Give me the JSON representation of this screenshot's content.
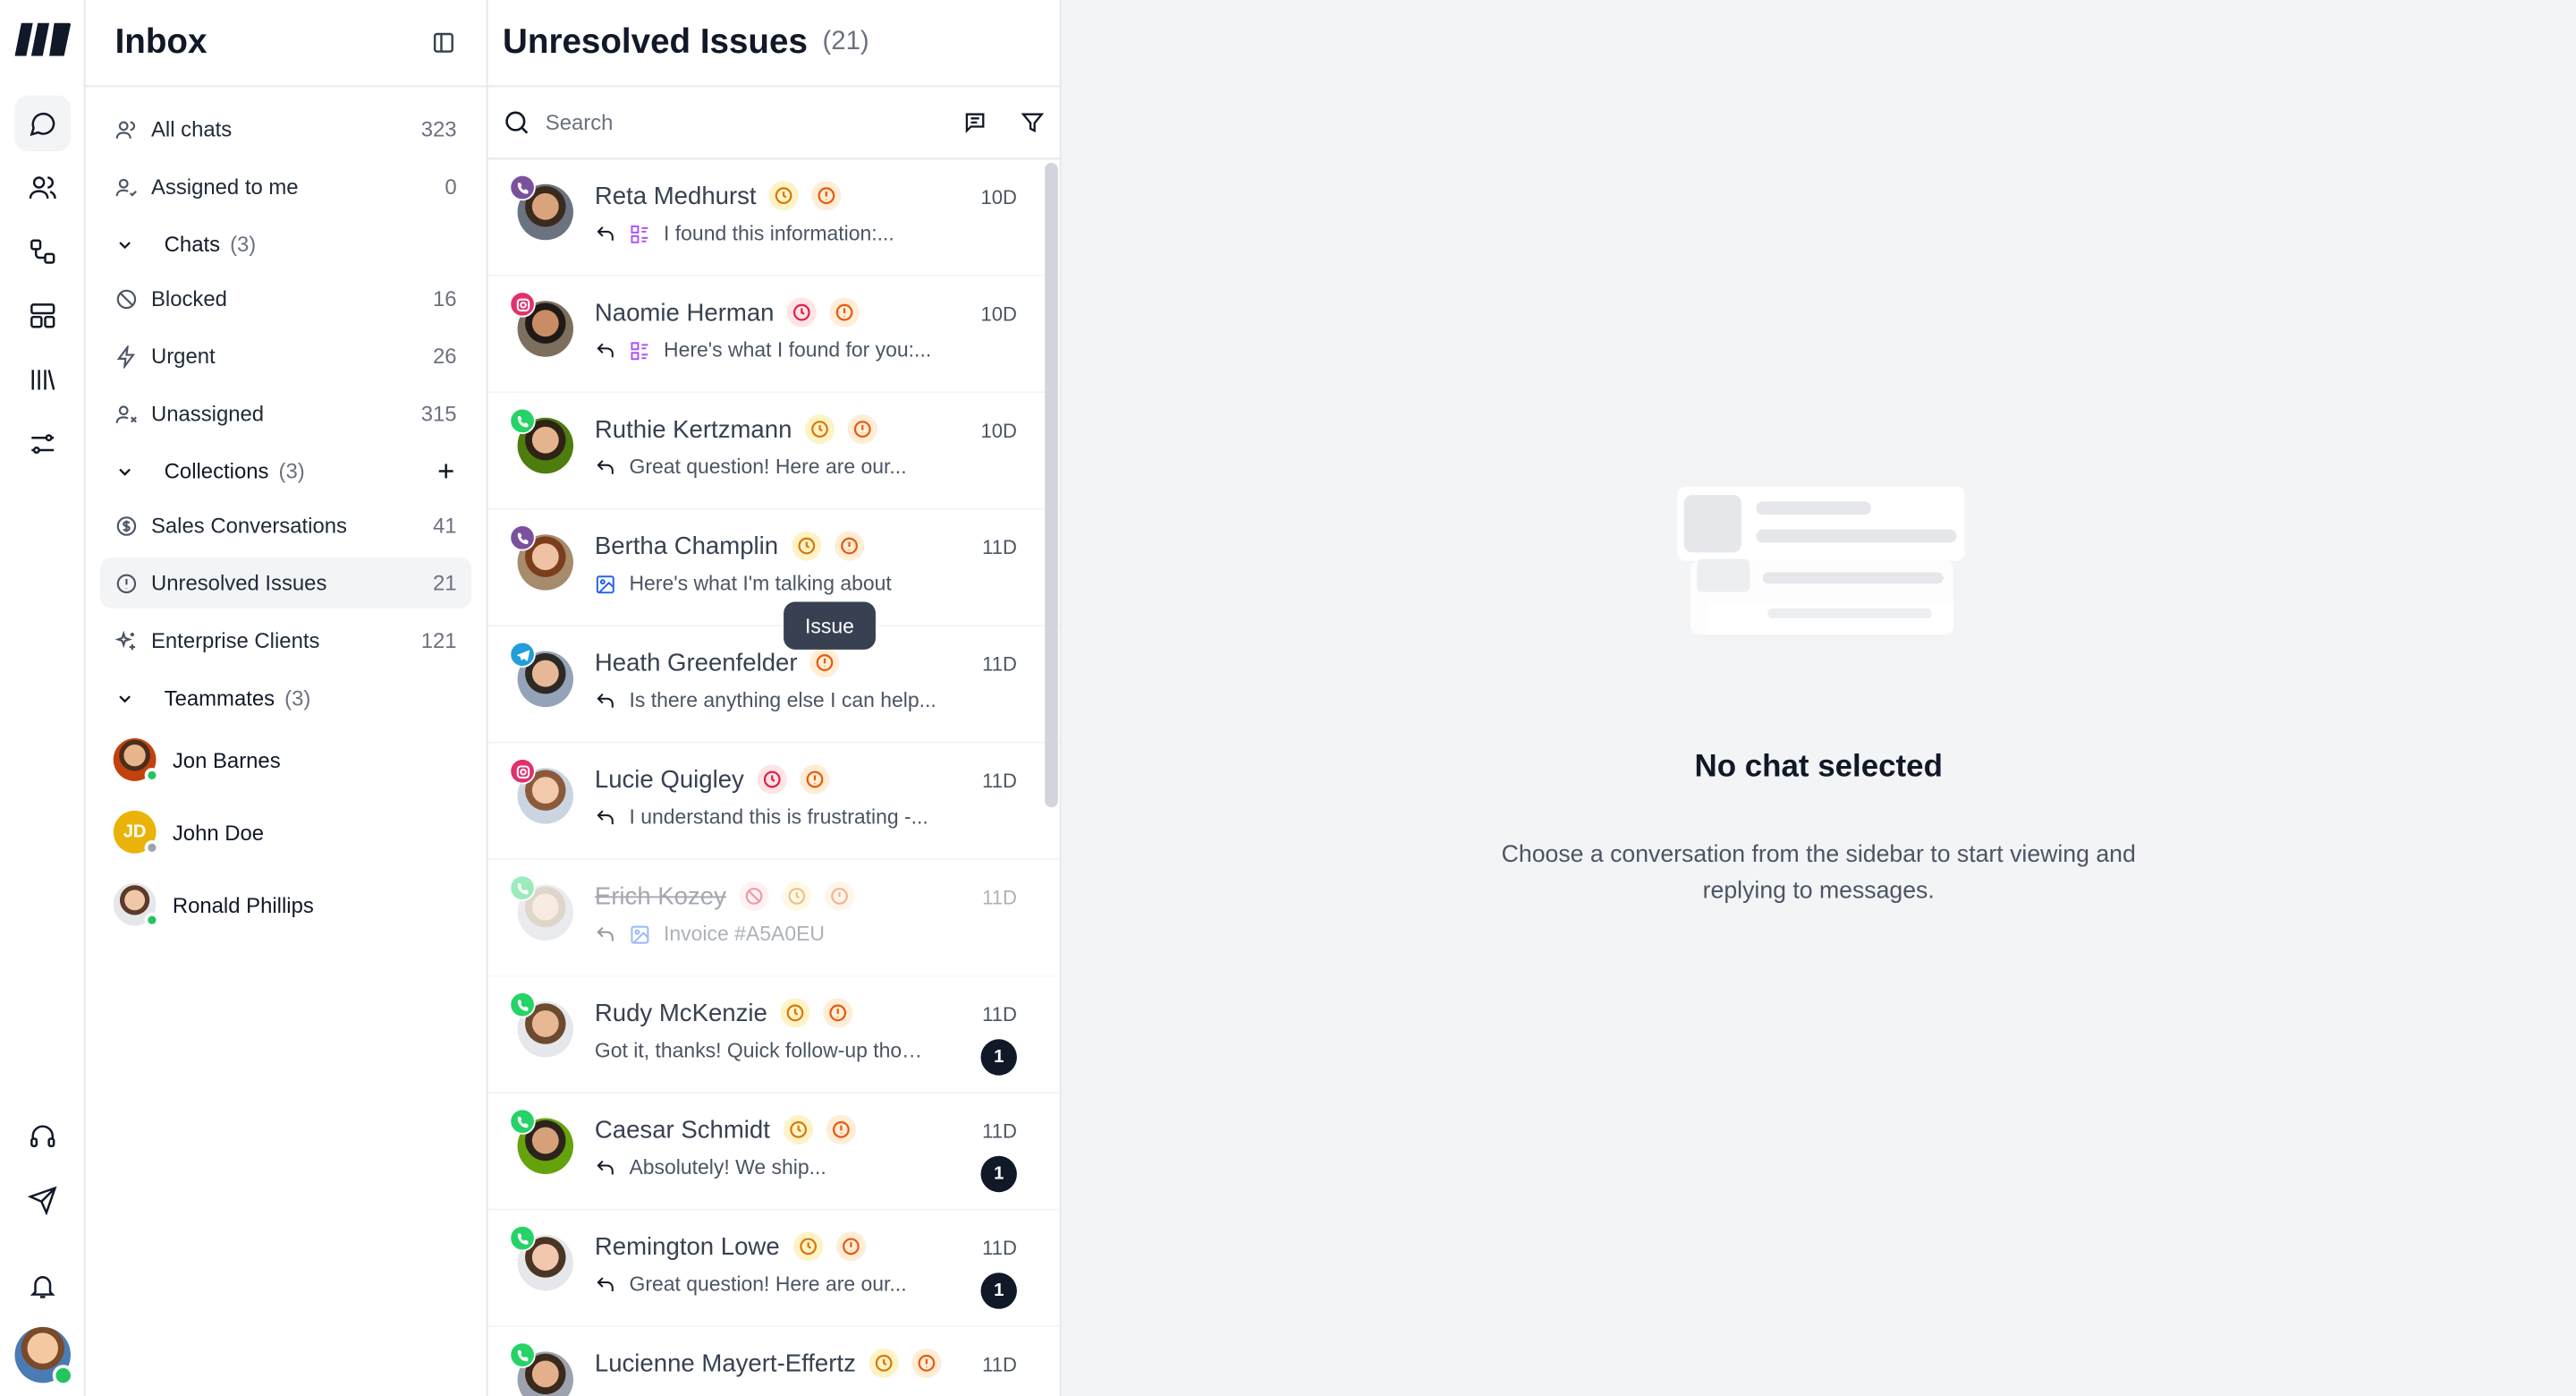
{
  "inbox": {
    "title": "Inbox",
    "nav": [
      {
        "label": "All chats",
        "count": "323",
        "icon": "users-icon"
      },
      {
        "label": "Assigned to me",
        "count": "0",
        "icon": "user-check-icon"
      }
    ],
    "chats_group": {
      "label": "Chats",
      "count": "(3)"
    },
    "chats_items": [
      {
        "label": "Blocked",
        "count": "16",
        "icon": "ban-icon"
      },
      {
        "label": "Urgent",
        "count": "26",
        "icon": "bolt-icon"
      },
      {
        "label": "Unassigned",
        "count": "315",
        "icon": "user-x-icon"
      }
    ],
    "collections_group": {
      "label": "Collections",
      "count": "(3)"
    },
    "collections_items": [
      {
        "label": "Sales Conversations",
        "count": "41",
        "icon": "dollar-icon"
      },
      {
        "label": "Unresolved Issues",
        "count": "21",
        "icon": "alert-circle-icon"
      },
      {
        "label": "Enterprise Clients",
        "count": "121",
        "icon": "sparkles-icon"
      }
    ],
    "teammates_group": {
      "label": "Teammates",
      "count": "(3)"
    },
    "teammates": [
      {
        "name": "Jon Barnes",
        "status": "online",
        "initials": ""
      },
      {
        "name": "John Doe",
        "status": "away",
        "initials": "JD"
      },
      {
        "name": "Ronald Phillips",
        "status": "online",
        "initials": ""
      }
    ]
  },
  "list": {
    "title": "Unresolved Issues",
    "count": "(21)",
    "search_placeholder": "Search",
    "tooltip": "Issue",
    "chats": [
      {
        "name": "Reta Medhurst",
        "channel": "viber",
        "tags": [
          "snooze",
          "issue"
        ],
        "preview": "I found this information:...",
        "replied": true,
        "attachment": "form",
        "time": "10D",
        "unread": ""
      },
      {
        "name": "Naomie Herman",
        "channel": "instagram",
        "tags": [
          "snooze-red",
          "issue"
        ],
        "preview": "Here's what I found for you:...",
        "replied": true,
        "attachment": "form",
        "time": "10D",
        "unread": ""
      },
      {
        "name": "Ruthie Kertzmann",
        "channel": "whatsapp",
        "tags": [
          "snooze",
          "issue"
        ],
        "preview": "Great question! Here are our...",
        "replied": true,
        "attachment": "",
        "time": "10D",
        "unread": ""
      },
      {
        "name": "Bertha Champlin",
        "channel": "viber",
        "tags": [
          "snooze",
          "issue"
        ],
        "preview": "Here's what I'm talking about",
        "replied": false,
        "attachment": "image",
        "time": "11D",
        "unread": ""
      },
      {
        "name": "Heath Greenfelder",
        "channel": "telegram",
        "tags": [
          "issue"
        ],
        "preview": "Is there anything else I can help...",
        "replied": true,
        "attachment": "",
        "time": "11D",
        "unread": ""
      },
      {
        "name": "Lucie Quigley",
        "channel": "instagram",
        "tags": [
          "snooze-red",
          "issue"
        ],
        "preview": "I understand this is frustrating -...",
        "replied": true,
        "attachment": "",
        "time": "11D",
        "unread": ""
      },
      {
        "name": "Erich Kozey",
        "channel": "whatsapp",
        "tags": [
          "block",
          "snooze",
          "issue"
        ],
        "preview": "Invoice #A5A0EU",
        "replied": true,
        "attachment": "image",
        "time": "11D",
        "unread": "",
        "blocked": true
      },
      {
        "name": "Rudy McKenzie",
        "channel": "whatsapp",
        "tags": [
          "snooze",
          "issue"
        ],
        "preview": "Got it, thanks! Quick follow-up thou...",
        "replied": false,
        "attachment": "",
        "time": "11D",
        "unread": "1"
      },
      {
        "name": "Caesar Schmidt",
        "channel": "whatsapp",
        "tags": [
          "snooze",
          "issue"
        ],
        "preview": "Absolutely! We ship...",
        "replied": true,
        "attachment": "",
        "time": "11D",
        "unread": "1"
      },
      {
        "name": "Remington Lowe",
        "channel": "whatsapp",
        "tags": [
          "snooze",
          "issue"
        ],
        "preview": "Great question! Here are our...",
        "replied": true,
        "attachment": "",
        "time": "11D",
        "unread": "1"
      },
      {
        "name": "Lucienne Mayert-Effertz",
        "channel": "whatsapp",
        "tags": [
          "snooze",
          "issue"
        ],
        "preview": "",
        "replied": false,
        "attachment": "",
        "time": "11D",
        "unread": ""
      }
    ]
  },
  "detail": {
    "empty_title": "No chat selected",
    "empty_subtitle": "Choose a conversation from the sidebar to start viewing and replying to messages."
  },
  "colors": {
    "viber": "#7b519d",
    "instagram": "#e1306c",
    "whatsapp": "#25d366",
    "telegram": "#229ed9",
    "online": "#22c55e",
    "away": "#9ca3af",
    "jd_avatar": "#eab308"
  }
}
